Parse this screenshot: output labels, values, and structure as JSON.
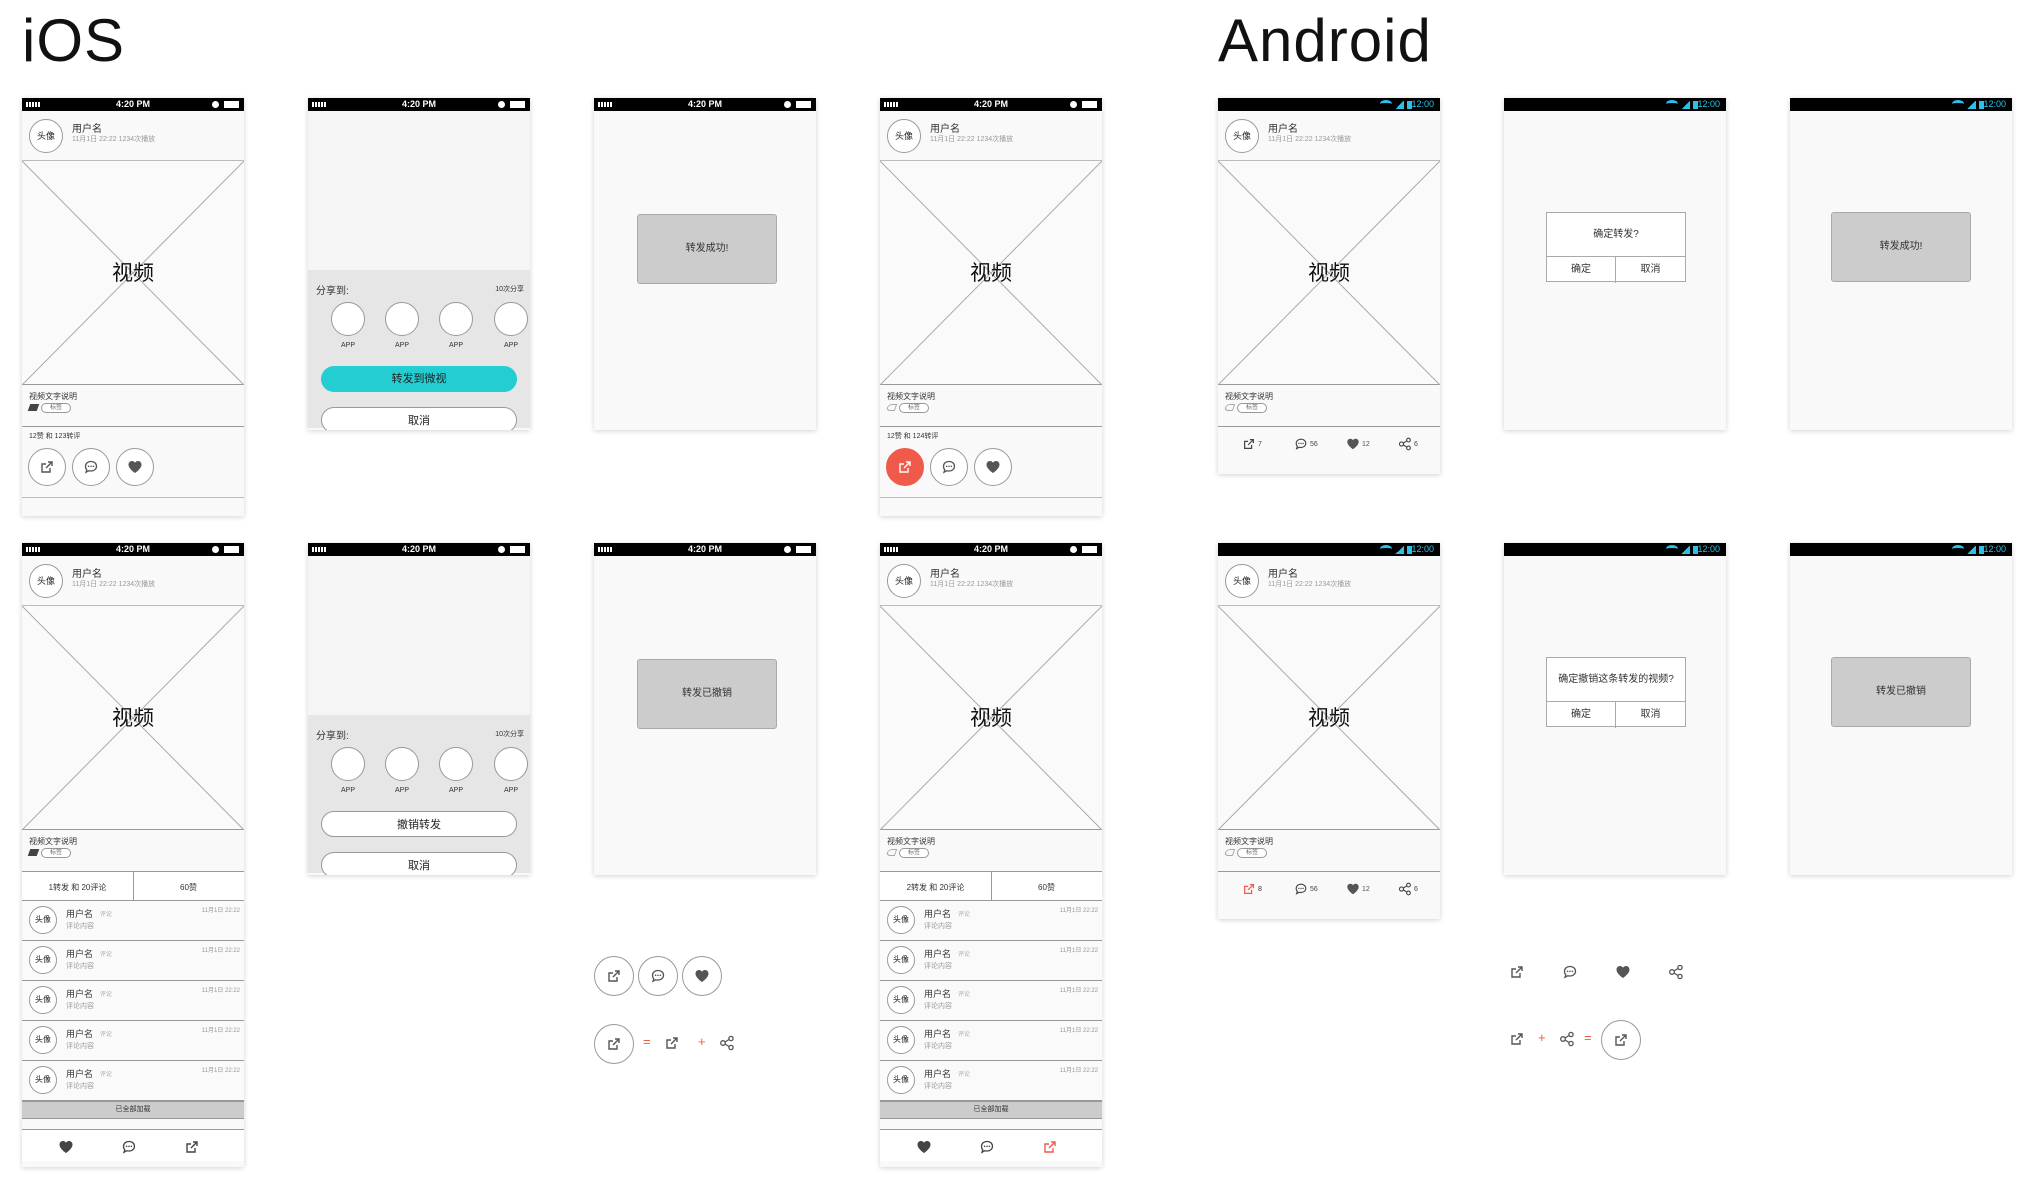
{
  "headings": {
    "ios": "iOS",
    "android": "Android"
  },
  "status": {
    "time": "4:20 PM",
    "android_time": "12:00"
  },
  "post": {
    "avatar": "头像",
    "username": "用户名",
    "meta": "11月1日 22:22  1234次播放",
    "video_label": "视频",
    "description": "视频文字说明",
    "tag": "标签",
    "likes_a": "12赞 和 123转评",
    "likes_b": "12赞 和 124转评"
  },
  "share_sheet": {
    "title": "分享到:",
    "count": "10次分享",
    "apps": [
      "APP",
      "APP",
      "APP",
      "APP"
    ],
    "forward_button": "转发到微视",
    "revoke_button": "撤销转发",
    "cancel_button": "取消"
  },
  "toasts": {
    "forward_success": "转发成功!",
    "forward_revoked": "转发已撤销"
  },
  "dialogs": {
    "confirm_forward": "确定转发?",
    "confirm_revoke": "确定撤销这条转发的视频?",
    "ok": "确定",
    "cancel": "取消"
  },
  "android_actions": {
    "a": {
      "forward": "7",
      "comment": "56",
      "like": "12",
      "share": "6"
    },
    "b": {
      "forward": "8",
      "comment": "56",
      "like": "12",
      "share": "6"
    }
  },
  "comments_header": {
    "a": {
      "left": "1转发 和 20评论",
      "right": "60赞"
    },
    "b": {
      "left": "2转发 和 20评论",
      "right": "60赞"
    }
  },
  "comments": [
    {
      "user": "用户名",
      "tag": "评论",
      "content": "评论内容",
      "date": "11月1日 22:22"
    },
    {
      "user": "用户名",
      "tag": "评论",
      "content": "评论内容",
      "date": "11月1日 22:22"
    },
    {
      "user": "用户名",
      "tag": "评论",
      "content": "评论内容",
      "date": "11月1日 22:22"
    },
    {
      "user": "用户名",
      "tag": "评论",
      "content": "评论内容",
      "date": "11月1日 22:22"
    },
    {
      "user": "用户名",
      "tag": "评论",
      "content": "评论内容",
      "date": "11月1日 22:22"
    }
  ],
  "all_loaded": "已全部加载",
  "legend_ops": {
    "eq": "=",
    "plus": "+"
  },
  "colors": {
    "accent_teal": "#23cdd2",
    "accent_red": "#f05a4a",
    "android_blue": "#2dc0e8"
  },
  "icons": [
    "forward-icon",
    "comment-icon",
    "heart-icon",
    "share-icon",
    "signal-icon",
    "battery-icon",
    "wifi-icon"
  ]
}
